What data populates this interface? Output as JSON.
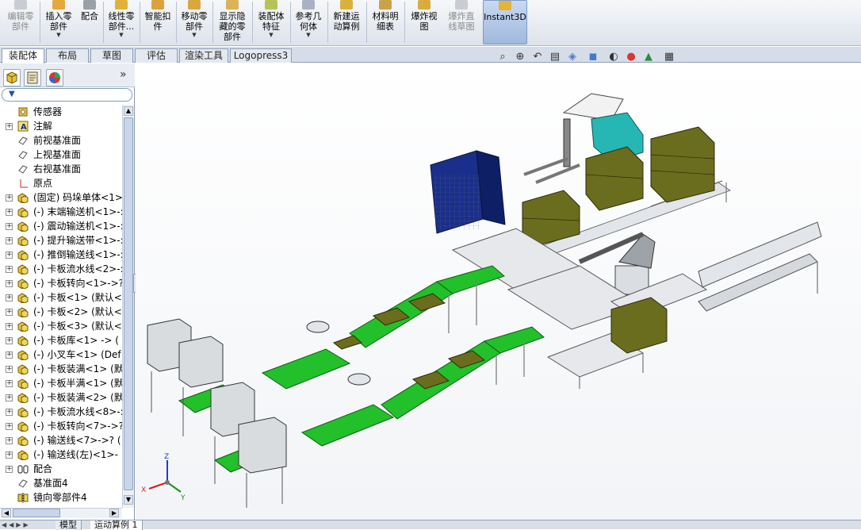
{
  "ribbon": {
    "buttons": [
      {
        "label": "编辑零\n部件",
        "icon": "edit-component-icon",
        "disabled": true
      },
      {
        "label": "插入零\n部件",
        "icon": "insert-component-icon",
        "dropdown": true
      },
      {
        "label": "配合",
        "icon": "mate-icon"
      },
      {
        "label": "线性零\n部件...",
        "icon": "linear-pattern-icon",
        "dropdown": true
      },
      {
        "label": "智能扣\n件",
        "icon": "smart-fastener-icon"
      },
      {
        "label": "移动零\n部件",
        "icon": "move-component-icon",
        "dropdown": true
      },
      {
        "label": "显示隐\n藏的零\n部件",
        "icon": "show-hidden-icon"
      },
      {
        "label": "装配体\n特征",
        "icon": "assembly-feature-icon",
        "dropdown": true
      },
      {
        "label": "参考几\n何体",
        "icon": "reference-geometry-icon",
        "dropdown": true
      },
      {
        "label": "新建运\n动算例",
        "icon": "motion-study-icon"
      },
      {
        "label": "材料明\n细表",
        "icon": "bom-icon"
      },
      {
        "label": "爆炸视\n图",
        "icon": "exploded-view-icon"
      },
      {
        "label": "爆炸直\n线草图",
        "icon": "explode-line-sketch-icon",
        "disabled": true
      },
      {
        "label": "Instant3D",
        "icon": "instant3d-icon",
        "active": true
      }
    ]
  },
  "command_tabs": [
    "装配体",
    "布局",
    "草图",
    "评估",
    "渲染工具",
    "Logopress3"
  ],
  "panel": {
    "collapse_glyph": "»",
    "filter_glyph": "▼",
    "tree": [
      {
        "label": "传感器",
        "icon": "sensor-icon",
        "expand": false
      },
      {
        "label": "注解",
        "icon": "annotation-icon",
        "expand": true
      },
      {
        "label": "前视基准面",
        "icon": "plane-icon",
        "expand": false
      },
      {
        "label": "上视基准面",
        "icon": "plane-icon",
        "expand": false
      },
      {
        "label": "右视基准面",
        "icon": "plane-icon",
        "expand": false
      },
      {
        "label": "原点",
        "icon": "origin-icon",
        "expand": false
      },
      {
        "label": "(固定) 码垛单体<1>-",
        "icon": "subassembly-icon",
        "expand": true
      },
      {
        "label": "(-) 末端输送机<1>-:",
        "icon": "subassembly-icon",
        "expand": true
      },
      {
        "label": "(-) 震动输送机<1>-:",
        "icon": "subassembly-icon",
        "expand": true
      },
      {
        "label": "(-) 提升输送带<1>-:",
        "icon": "subassembly-icon",
        "expand": true
      },
      {
        "label": "(-) 推倒输送线<1>-:",
        "icon": "subassembly-icon",
        "expand": true
      },
      {
        "label": "(-) 卡板流水线<2>-:",
        "icon": "subassembly-icon",
        "expand": true
      },
      {
        "label": "(-) 卡板转向<1>->?",
        "icon": "subassembly-icon",
        "expand": true
      },
      {
        "label": "(-) 卡板<1> (默认<",
        "icon": "subassembly-icon",
        "expand": true
      },
      {
        "label": "(-) 卡板<2> (默认<",
        "icon": "subassembly-icon",
        "expand": true
      },
      {
        "label": "(-) 卡板<3> (默认<",
        "icon": "subassembly-icon",
        "expand": true
      },
      {
        "label": "(-) 卡板库<1> -> (",
        "icon": "subassembly-icon",
        "expand": true
      },
      {
        "label": "(-) 小叉车<1> (Def",
        "icon": "subassembly-icon",
        "expand": true
      },
      {
        "label": "(-) 卡板装满<1> (默",
        "icon": "subassembly-icon",
        "expand": true
      },
      {
        "label": "(-) 卡板半满<1> (默",
        "icon": "subassembly-icon",
        "expand": true
      },
      {
        "label": "(-) 卡板装满<2> (默",
        "icon": "subassembly-icon",
        "expand": true
      },
      {
        "label": "(-) 卡板流水线<8>-:",
        "icon": "subassembly-icon",
        "expand": true
      },
      {
        "label": "(-) 卡板转向<7>->?",
        "icon": "subassembly-icon",
        "expand": true
      },
      {
        "label": "(-) 输送线<7>->? (",
        "icon": "subassembly-icon",
        "expand": true
      },
      {
        "label": "(-) 输送线(左)<1>-",
        "icon": "subassembly-icon",
        "expand": true
      },
      {
        "label": "配合",
        "icon": "mates-folder-icon",
        "expand": true
      },
      {
        "label": "基准面4",
        "icon": "plane-icon",
        "expand": false
      },
      {
        "label": "镜向零部件4",
        "icon": "mirror-component-icon",
        "expand": false
      }
    ]
  },
  "viewport": {
    "triad": {
      "x": "X",
      "y": "Y",
      "z": "Z"
    },
    "view_tools": [
      "zoom-to-fit-icon",
      "zoom-area-icon",
      "previous-view-icon",
      "section-view-icon",
      "view-orientation-icon",
      "display-style-icon",
      "hide-show-items-icon",
      "edit-appearance-icon",
      "apply-scene-icon",
      "view-settings-icon"
    ]
  },
  "bottom_tabs": [
    "模型",
    "运动算例 1"
  ],
  "colors": {
    "accent": "#2e66b5",
    "conveyor_green": "#22c02a",
    "box_olive": "#6b6d1e",
    "frame_gray": "#b8bcc2",
    "rack_navy": "#1a2f8a",
    "forklift_teal": "#26b7b4"
  }
}
